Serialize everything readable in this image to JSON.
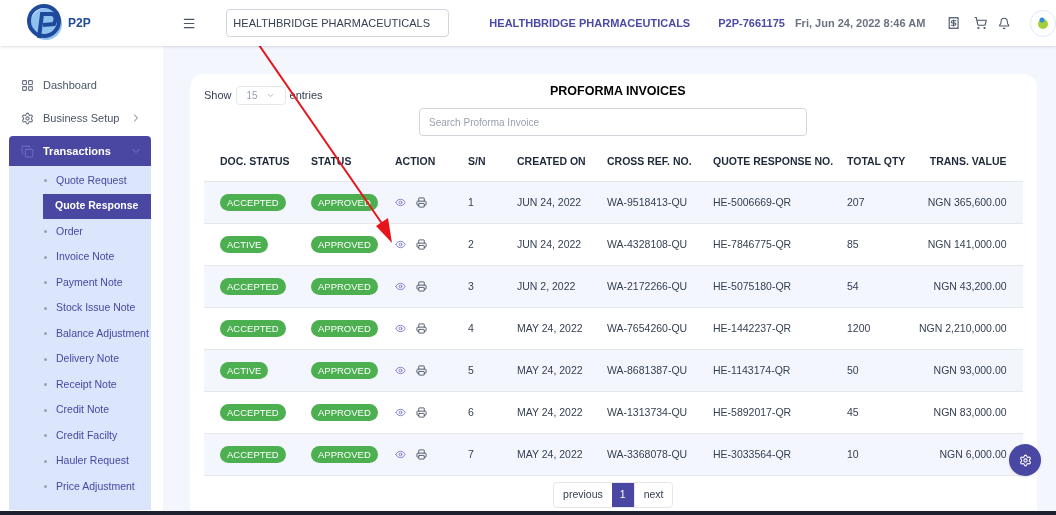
{
  "header": {
    "logo_text": "P2P",
    "company_select": {
      "value": "HEALTHBRIDGE PHARMACEUTICALS"
    },
    "company_name": "HEALTHBRIDGE PHARMACEUTICALS",
    "user_id": "P2P-7661175",
    "datetime": "Fri, Jun 24, 2022 8:46 AM"
  },
  "sidebar": {
    "items": [
      {
        "label": "Dashboard",
        "kind": "dashboard",
        "selected": false
      },
      {
        "label": "Business Setup",
        "kind": "setup",
        "selected": false,
        "expanded": false
      },
      {
        "label": "Transactions",
        "kind": "transactions",
        "selected": true,
        "expanded": true,
        "children": [
          {
            "label": "Quote Request",
            "selected": false
          },
          {
            "label": "Quote Response",
            "selected": true
          },
          {
            "label": "Order",
            "selected": false
          },
          {
            "label": "Invoice Note",
            "selected": false
          },
          {
            "label": "Payment Note",
            "selected": false
          },
          {
            "label": "Stock Issue Note",
            "selected": false
          },
          {
            "label": "Balance Adjustment",
            "selected": false
          },
          {
            "label": "Delivery Note",
            "selected": false
          },
          {
            "label": "Receipt Note",
            "selected": false
          },
          {
            "label": "Credit Note",
            "selected": false
          },
          {
            "label": "Credit Facilty",
            "selected": false
          },
          {
            "label": "Hauler Request",
            "selected": false
          },
          {
            "label": "Price Adjustment",
            "selected": false
          }
        ]
      }
    ]
  },
  "card": {
    "title": "PROFORMA INVOICES",
    "show_label": "Show",
    "entries_value": "15",
    "entries_label": "entries",
    "search": {
      "placeholder": "Search Proforma Invoice"
    },
    "table": {
      "columns": [
        "DOC. STATUS",
        "STATUS",
        "ACTION",
        "S/N",
        "CREATED ON",
        "CROSS REF. NO.",
        "QUOTE RESPONSE NO.",
        "TOTAL QTY",
        "TRANS. VALUE"
      ],
      "rows": [
        {
          "doc_status": "ACCEPTED",
          "status": "APPROVED",
          "sn": "1",
          "created_on": "JUN 24, 2022",
          "cross_ref": "WA-9518413-QU",
          "quote_response_no": "HE-5006669-QR",
          "total_qty": "207",
          "trans_value": "NGN 365,600.00"
        },
        {
          "doc_status": "ACTIVE",
          "status": "APPROVED",
          "sn": "2",
          "created_on": "JUN 24, 2022",
          "cross_ref": "WA-4328108-QU",
          "quote_response_no": "HE-7846775-QR",
          "total_qty": "85",
          "trans_value": "NGN 141,000.00"
        },
        {
          "doc_status": "ACCEPTED",
          "status": "APPROVED",
          "sn": "3",
          "created_on": "JUN 2, 2022",
          "cross_ref": "WA-2172266-QU",
          "quote_response_no": "HE-5075180-QR",
          "total_qty": "54",
          "trans_value": "NGN 43,200.00"
        },
        {
          "doc_status": "ACCEPTED",
          "status": "APPROVED",
          "sn": "4",
          "created_on": "MAY 24, 2022",
          "cross_ref": "WA-7654260-QU",
          "quote_response_no": "HE-1442237-QR",
          "total_qty": "1200",
          "trans_value": "NGN 2,210,000.00"
        },
        {
          "doc_status": "ACTIVE",
          "status": "APPROVED",
          "sn": "5",
          "created_on": "MAY 24, 2022",
          "cross_ref": "WA-8681387-QU",
          "quote_response_no": "HE-1143174-QR",
          "total_qty": "50",
          "trans_value": "NGN 93,000.00"
        },
        {
          "doc_status": "ACCEPTED",
          "status": "APPROVED",
          "sn": "6",
          "created_on": "MAY 24, 2022",
          "cross_ref": "WA-1313734-QU",
          "quote_response_no": "HE-5892017-QR",
          "total_qty": "45",
          "trans_value": "NGN 83,000.00"
        },
        {
          "doc_status": "ACCEPTED",
          "status": "APPROVED",
          "sn": "7",
          "created_on": "MAY 24, 2022",
          "cross_ref": "WA-3368078-QU",
          "quote_response_no": "HE-3033564-QR",
          "total_qty": "10",
          "trans_value": "NGN 6,000.00"
        }
      ]
    },
    "pagination": {
      "previous": "previous",
      "pages": [
        {
          "label": "1",
          "selected": true
        }
      ],
      "next": "next"
    }
  }
}
